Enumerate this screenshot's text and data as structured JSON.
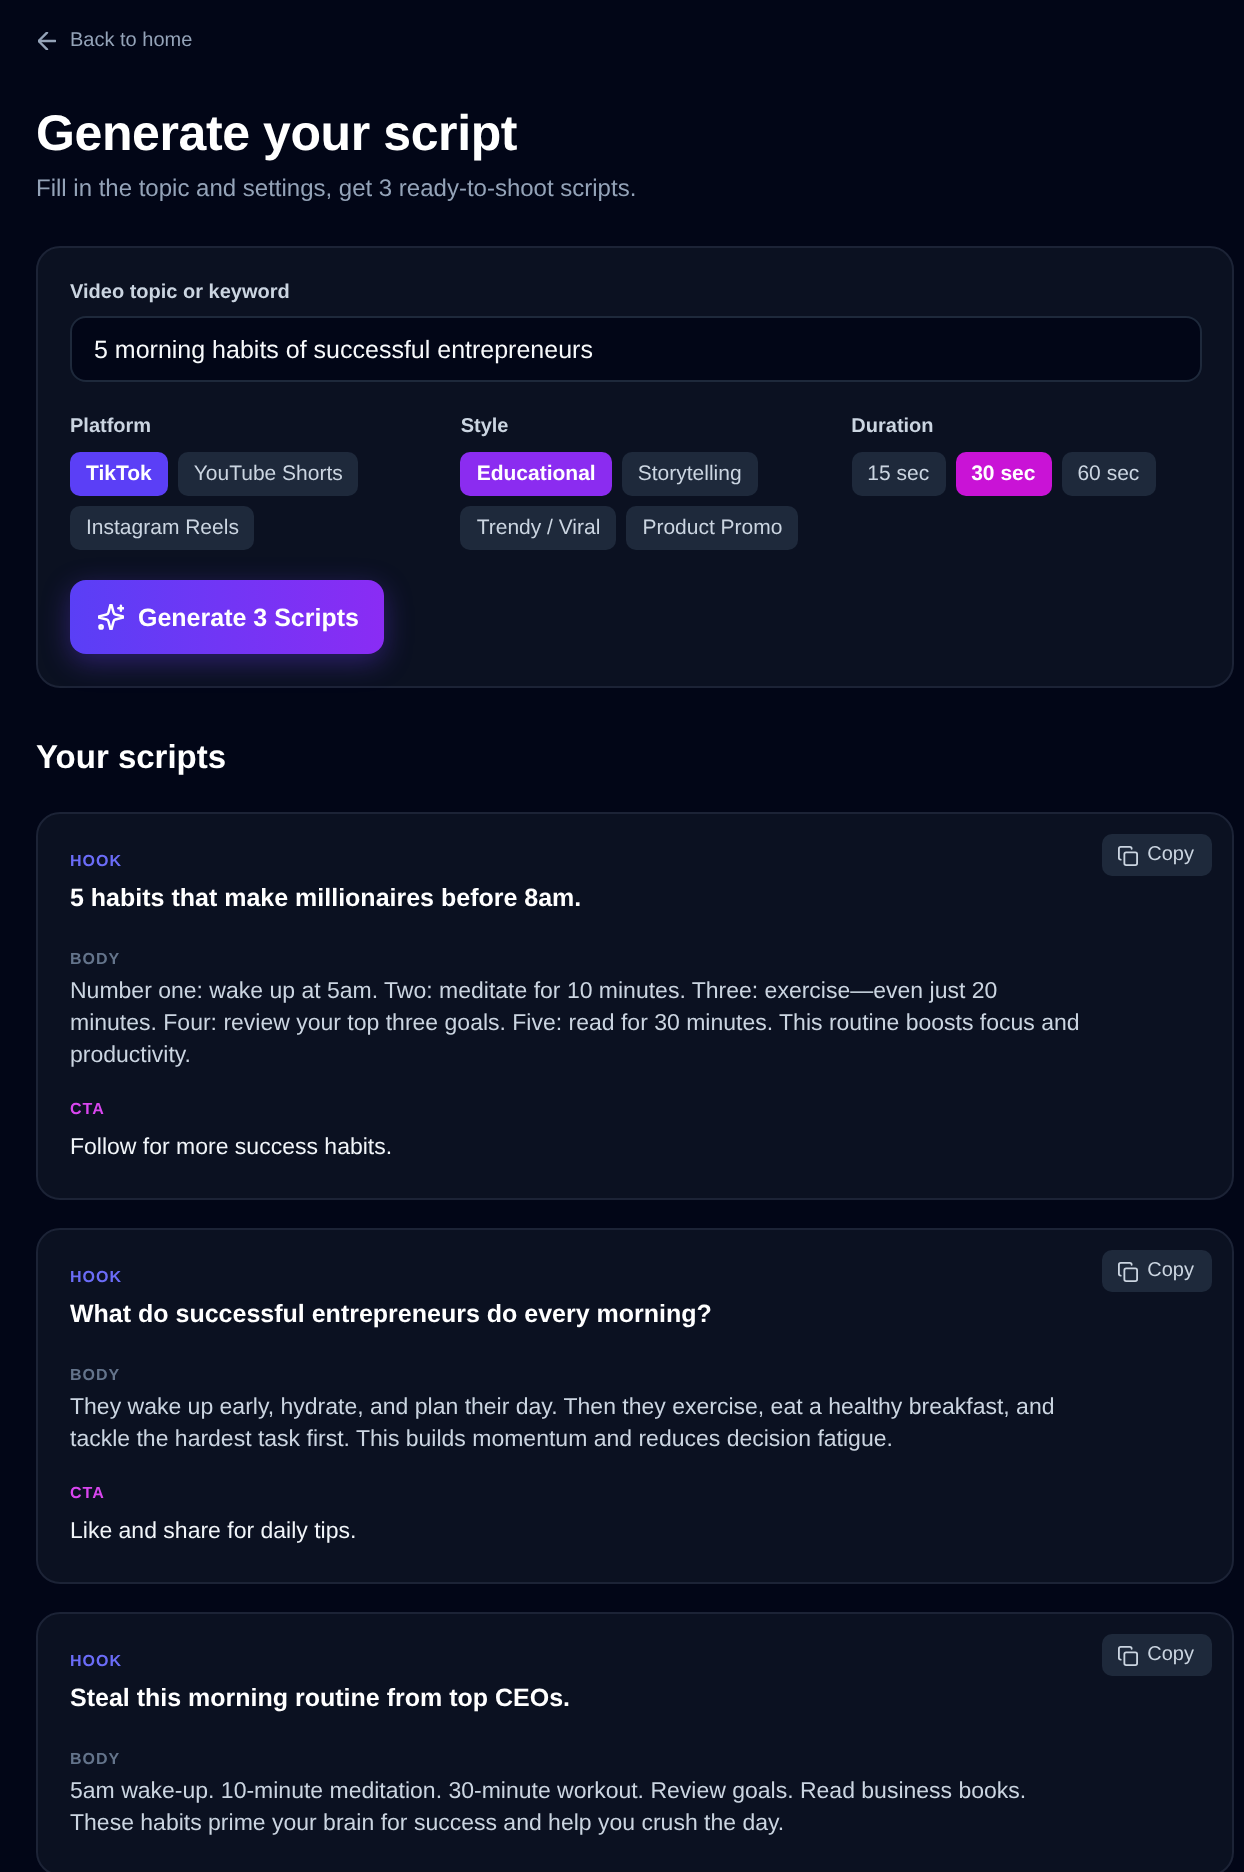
{
  "back_link": {
    "label": "Back to home"
  },
  "header": {
    "title": "Generate your script",
    "subtitle": "Fill in the topic and settings, get 3 ready-to-shoot scripts."
  },
  "form": {
    "topic": {
      "label": "Video topic or keyword",
      "value": "5 morning habits of successful entrepreneurs"
    },
    "groups": [
      {
        "kind": "platform",
        "label": "Platform",
        "options": [
          {
            "label": "TikTok",
            "selected": true
          },
          {
            "label": "YouTube Shorts",
            "selected": false
          },
          {
            "label": "Instagram Reels",
            "selected": false
          }
        ]
      },
      {
        "kind": "style",
        "label": "Style",
        "options": [
          {
            "label": "Educational",
            "selected": true
          },
          {
            "label": "Storytelling",
            "selected": false
          },
          {
            "label": "Trendy / Viral",
            "selected": false
          },
          {
            "label": "Product Promo",
            "selected": false
          }
        ]
      },
      {
        "kind": "duration",
        "label": "Duration",
        "options": [
          {
            "label": "15 sec",
            "selected": false
          },
          {
            "label": "30 sec",
            "selected": true
          },
          {
            "label": "60 sec",
            "selected": false
          }
        ]
      }
    ],
    "generate_button": {
      "label": "Generate 3 Scripts"
    }
  },
  "results": {
    "title": "Your scripts",
    "scripts": [
      {
        "copy_button": "Copy",
        "sections": [
          {
            "kind": "hook",
            "label": "HOOK",
            "text": "5 habits that make millionaires before 8am."
          },
          {
            "kind": "body",
            "label": "BODY",
            "text": "Number one: wake up at 5am. Two: meditate for 10 minutes. Three: exercise—even just 20 minutes. Four: review your top three goals. Five: read for 30 minutes. This routine boosts focus and productivity."
          },
          {
            "kind": "cta",
            "label": "CTA",
            "text": "Follow for more success habits."
          }
        ]
      },
      {
        "copy_button": "Copy",
        "sections": [
          {
            "kind": "hook",
            "label": "HOOK",
            "text": "What do successful entrepreneurs do every morning?"
          },
          {
            "kind": "body",
            "label": "BODY",
            "text": "They wake up early, hydrate, and plan their day. Then they exercise, eat a healthy breakfast, and tackle the hardest task first. This builds momentum and reduces decision fatigue."
          },
          {
            "kind": "cta",
            "label": "CTA",
            "text": "Like and share for daily tips."
          }
        ]
      },
      {
        "copy_button": "Copy",
        "sections": [
          {
            "kind": "hook",
            "label": "HOOK",
            "text": "Steal this morning routine from top CEOs."
          },
          {
            "kind": "body",
            "label": "BODY",
            "text": "5am wake-up. 10-minute meditation. 30-minute workout. Review goals. Read business books. These habits prime your brain for success and help you crush the day."
          }
        ]
      }
    ]
  }
}
